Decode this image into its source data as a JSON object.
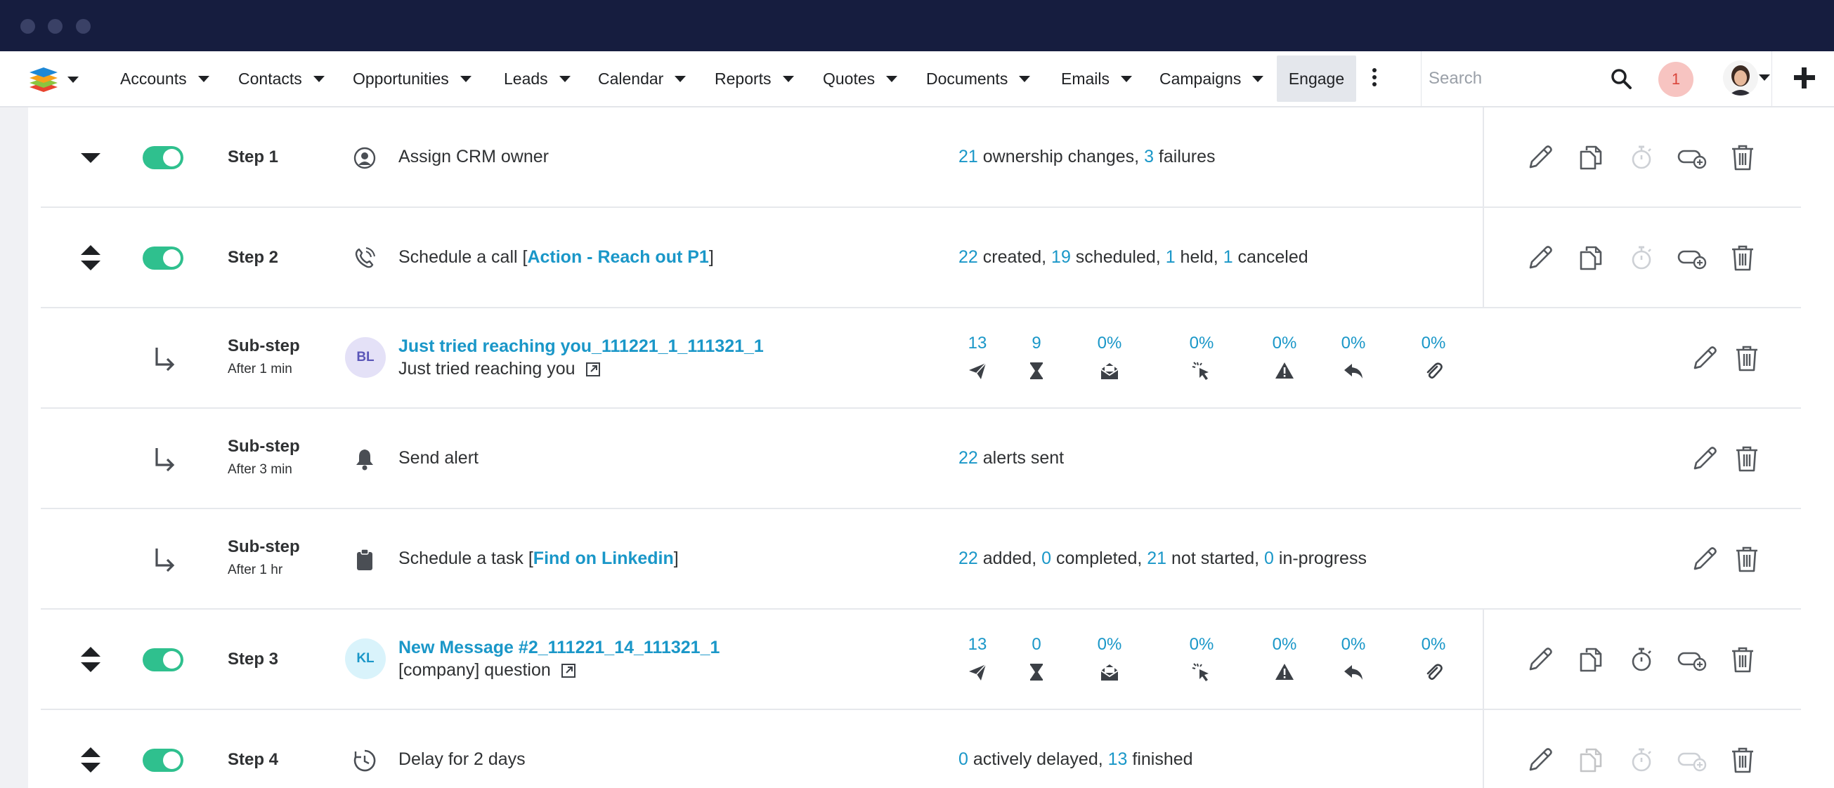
{
  "nav": {
    "items": [
      {
        "label": "Accounts"
      },
      {
        "label": "Contacts"
      },
      {
        "label": "Opportunities"
      },
      {
        "label": "Leads"
      },
      {
        "label": "Calendar"
      },
      {
        "label": "Reports"
      },
      {
        "label": "Quotes"
      },
      {
        "label": "Documents"
      },
      {
        "label": "Emails"
      },
      {
        "label": "Campaigns"
      }
    ],
    "active": "Engage",
    "search_placeholder": "Search",
    "notification_count": "1"
  },
  "colors": {
    "titlebar": "#161d3f",
    "accent": "#1a97c8",
    "toggle_on": "#2fc08e",
    "notification": "#f7c4c1"
  },
  "steps": [
    {
      "label": "Step 1",
      "icon": "user-circle-icon",
      "description": "Assign CRM owner",
      "stats": [
        {
          "n": "21",
          "t": " ownership changes, "
        },
        {
          "n": "3",
          "t": " failures"
        }
      ]
    },
    {
      "label": "Step 2",
      "icon": "phone-icon",
      "description_prefix": "Schedule a call [",
      "description_link": "Action - Reach out P1",
      "description_suffix": "]",
      "stats": [
        {
          "n": "22",
          "t": " created, "
        },
        {
          "n": "19",
          "t": " scheduled, "
        },
        {
          "n": "1",
          "t": " held, "
        },
        {
          "n": "1",
          "t": " canceled"
        }
      ]
    },
    {
      "label": "Sub-step",
      "delay": "After 1 min",
      "badge": "BL",
      "title": "Just tried reaching you_111221_1_111321_1",
      "subtitle": "Just tried reaching you",
      "metrics": [
        "13",
        "9",
        "0%",
        "0%",
        "0%",
        "0%",
        "0%"
      ]
    },
    {
      "label": "Sub-step",
      "delay": "After 3 min",
      "icon": "bell-icon",
      "description": "Send alert",
      "stats": [
        {
          "n": "22",
          "t": " alerts sent"
        }
      ]
    },
    {
      "label": "Sub-step",
      "delay": "After 1 hr",
      "icon": "clipboard-icon",
      "description_prefix": "Schedule a task [",
      "description_link": "Find on Linkedin",
      "description_suffix": "]",
      "stats": [
        {
          "n": "22",
          "t": " added, "
        },
        {
          "n": "0",
          "t": " completed, "
        },
        {
          "n": "21",
          "t": " not started, "
        },
        {
          "n": "0",
          "t": " in-progress"
        }
      ]
    },
    {
      "label": "Step 3",
      "badge": "KL",
      "title": "New Message #2_111221_14_111321_1",
      "subtitle": "[company] question",
      "metrics": [
        "13",
        "0",
        "0%",
        "0%",
        "0%",
        "0%",
        "0%"
      ]
    },
    {
      "label": "Step 4",
      "icon": "delay-clock-icon",
      "description": "Delay for 2 days",
      "stats": [
        {
          "n": "0",
          "t": " actively delayed, "
        },
        {
          "n": "13",
          "t": " finished"
        }
      ]
    }
  ]
}
